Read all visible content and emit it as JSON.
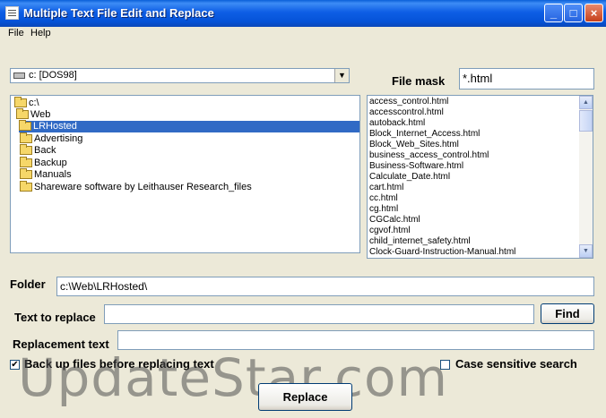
{
  "window": {
    "title": "Multiple Text File Edit and Replace"
  },
  "title_buttons": {
    "minimize": "_",
    "maximize": "□",
    "close": "×"
  },
  "menu": {
    "file": "File",
    "help": "Help"
  },
  "drive": {
    "value": "c: [DOS98]",
    "arrow": "▼"
  },
  "file_mask": {
    "label": "File mask",
    "value": "*.html"
  },
  "folders": [
    {
      "name": "c:\\",
      "selected": false
    },
    {
      "name": "Web",
      "selected": false
    },
    {
      "name": "LRHosted",
      "selected": true
    },
    {
      "name": "Advertising",
      "selected": false
    },
    {
      "name": "Back",
      "selected": false
    },
    {
      "name": "Backup",
      "selected": false
    },
    {
      "name": "Manuals",
      "selected": false
    },
    {
      "name": "Shareware software by Leithauser Research_files",
      "selected": false
    }
  ],
  "files": [
    "access_control.html",
    "accesscontrol.html",
    "autoback.html",
    "Block_Internet_Access.html",
    "Block_Web_Sites.html",
    "business_access_control.html",
    "Business-Software.html",
    "Calculate_Date.html",
    "cart.html",
    "cc.html",
    "cg.html",
    "CGCalc.html",
    "cgvof.html",
    "child_internet_safety.html",
    "Clock-Guard-Instruction-Manual.html"
  ],
  "scroll_arrows": {
    "up": "▲",
    "down": "▼"
  },
  "folder_field": {
    "label": "Folder",
    "value": "c:\\Web\\LRHosted\\"
  },
  "text_to_replace": {
    "label": "Text to replace",
    "value": ""
  },
  "find_button": "Find",
  "replacement_text": {
    "label": "Replacement text",
    "value": ""
  },
  "backup_checkbox": {
    "label": "Back up files before replacing text",
    "checked": true,
    "mark": "✔"
  },
  "case_checkbox": {
    "label": "Case sensitive search",
    "checked": false
  },
  "replace_button": "Replace",
  "watermark": "UpdateStar.com"
}
